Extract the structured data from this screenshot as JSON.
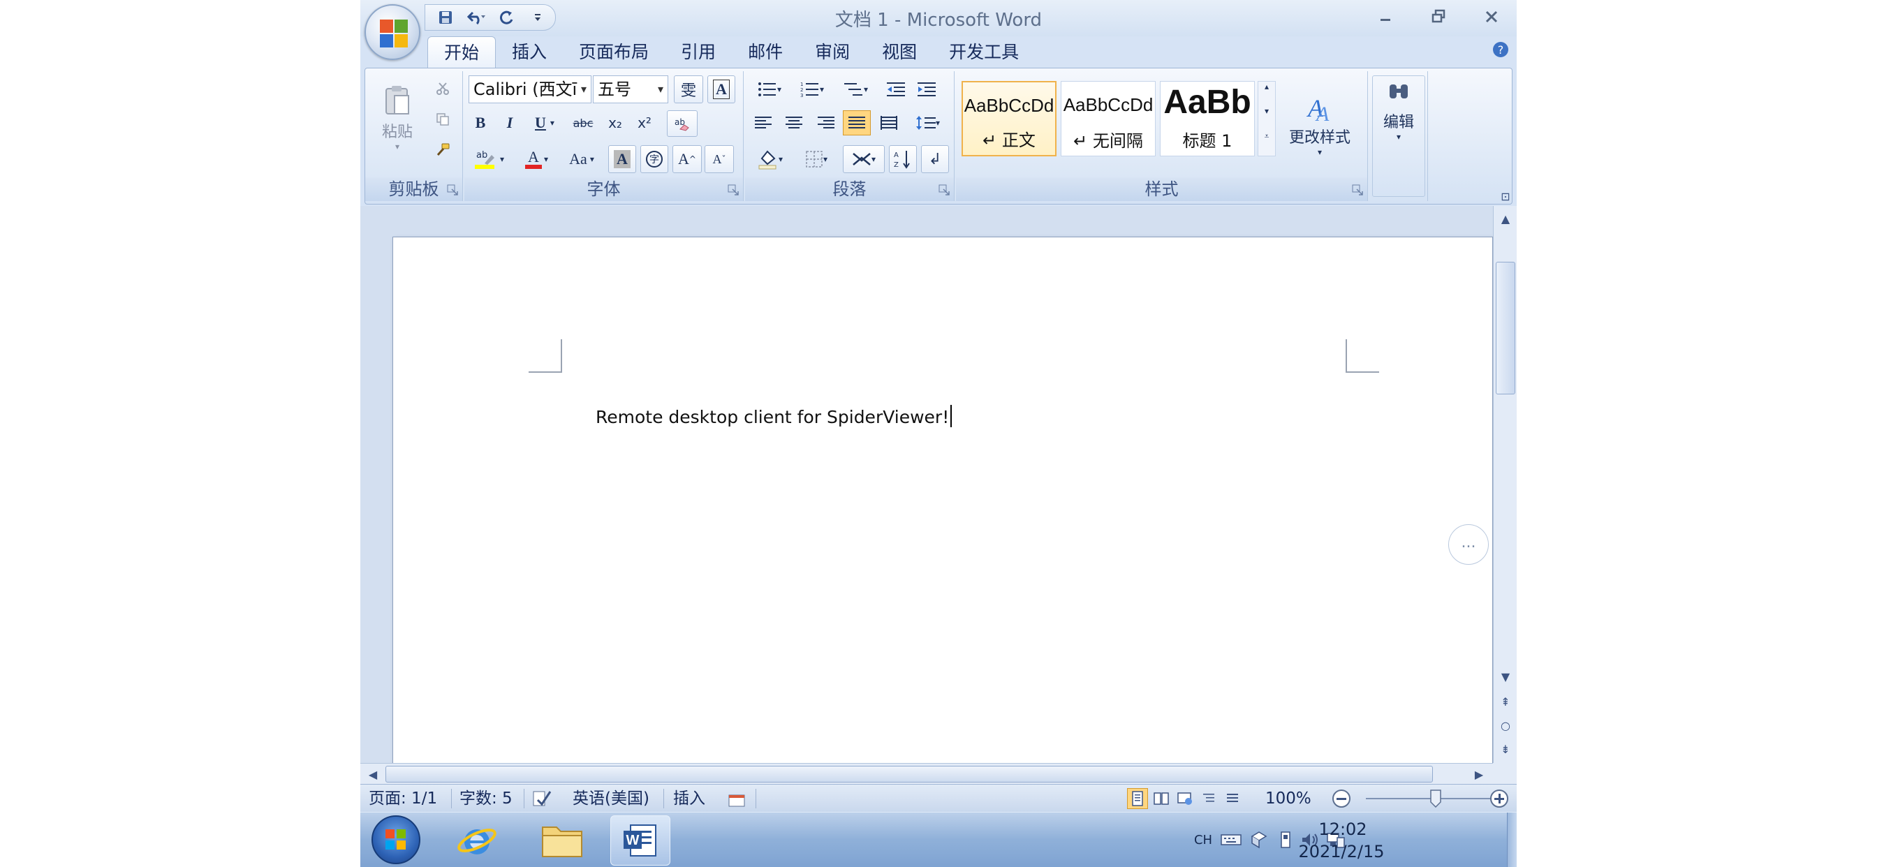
{
  "window": {
    "title": "文档 1 - Microsoft Word"
  },
  "tabs": [
    {
      "label": "开始",
      "active": true
    },
    {
      "label": "插入"
    },
    {
      "label": "页面布局"
    },
    {
      "label": "引用"
    },
    {
      "label": "邮件"
    },
    {
      "label": "审阅"
    },
    {
      "label": "视图"
    },
    {
      "label": "开发工具"
    }
  ],
  "ribbon": {
    "clipboard": {
      "paste_label": "粘贴",
      "group_label": "剪贴板"
    },
    "font": {
      "font_name": "Calibri (西文ī",
      "font_size": "五号",
      "bold": "B",
      "italic": "I",
      "underline": "U",
      "strike": "abc",
      "subscript": "x₂",
      "superscript": "x²",
      "change_case": "Aa",
      "char_border": "A",
      "grow": "A",
      "shrink": "A",
      "group_label": "字体"
    },
    "paragraph": {
      "group_label": "段落"
    },
    "styles": {
      "tiles": [
        {
          "sample": "AaBbCcDd",
          "name": "↵ 正文",
          "selected": true
        },
        {
          "sample": "AaBbCcDd",
          "name": "↵ 无间隔"
        },
        {
          "sample": "AaBb",
          "name": "标题 1"
        }
      ],
      "change_styles_label": "更改样式",
      "group_label": "样式"
    },
    "editing": {
      "label": "编辑"
    }
  },
  "document": {
    "text": "Remote desktop client for SpiderViewer!",
    "more_button": "..."
  },
  "statusbar": {
    "page": "页面: 1/1",
    "words": "字数: 5",
    "language": "英语(美国)",
    "mode": "插入",
    "zoom": "100%"
  },
  "taskbar": {
    "ime": "CH",
    "time": "12:02",
    "date": "2021/2/15"
  },
  "colors": {
    "ribbon_bg": "#dfe9f5",
    "accent": "#f0b24b",
    "taskbar": "#8fb0d9"
  }
}
